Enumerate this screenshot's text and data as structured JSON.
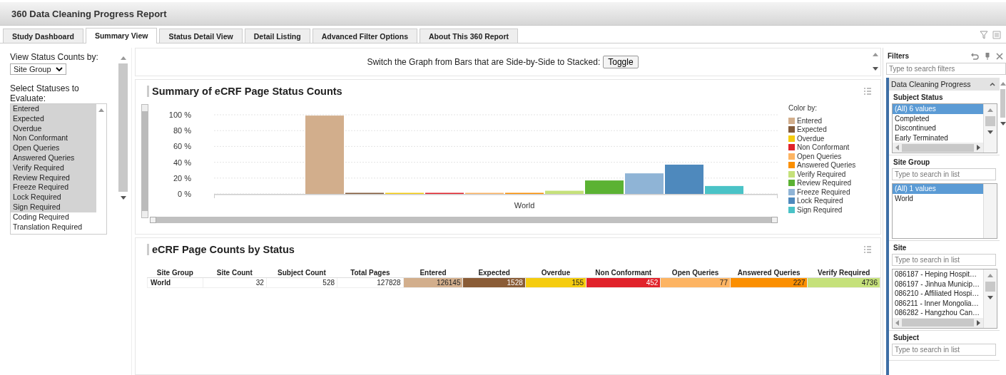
{
  "window": {
    "title": "360 Data Cleaning Progress Report"
  },
  "tabs": [
    {
      "label": "Study Dashboard",
      "selected": false
    },
    {
      "label": "Summary View",
      "selected": true
    },
    {
      "label": "Status Detail View",
      "selected": false
    },
    {
      "label": "Detail Listing",
      "selected": false
    },
    {
      "label": "Advanced Filter Options",
      "selected": false
    },
    {
      "label": "About This 360 Report",
      "selected": false
    }
  ],
  "left_panel": {
    "view_by_label": "View Status Counts by:",
    "view_by_value": "Site Group",
    "statuses_label": "Select Statuses to Evaluate:",
    "statuses": [
      {
        "label": "Entered",
        "selected": true
      },
      {
        "label": "Expected",
        "selected": true
      },
      {
        "label": "Overdue",
        "selected": true
      },
      {
        "label": "Non Conformant",
        "selected": true
      },
      {
        "label": "Open Queries",
        "selected": true
      },
      {
        "label": "Answered Queries",
        "selected": true
      },
      {
        "label": "Verify Required",
        "selected": true
      },
      {
        "label": "Review Required",
        "selected": true
      },
      {
        "label": "Freeze Required",
        "selected": true
      },
      {
        "label": "Lock Required",
        "selected": true
      },
      {
        "label": "Sign Required",
        "selected": true
      },
      {
        "label": "Coding Required",
        "selected": false
      },
      {
        "label": "Translation Required",
        "selected": false
      }
    ]
  },
  "toggle_bar": {
    "text": "Switch the Graph from Bars that are Side-by-Side to Stacked:",
    "button": "Toggle"
  },
  "chart_panel": {
    "title": "Summary of eCRF Page Status Counts",
    "legend_title": "Color by:",
    "chart_data": {
      "type": "bar",
      "grid": true,
      "categories": [
        "World"
      ],
      "ylim": [
        0,
        100
      ],
      "yticks": [
        {
          "value": 0,
          "label": "0 %"
        },
        {
          "value": 20,
          "label": "20 %"
        },
        {
          "value": 40,
          "label": "40 %"
        },
        {
          "value": 60,
          "label": "60 %"
        },
        {
          "value": 80,
          "label": "80 %"
        },
        {
          "value": 100,
          "label": "100 %"
        }
      ],
      "series": [
        {
          "name": "Entered",
          "color": "#d2ae8c",
          "values": [
            99
          ]
        },
        {
          "name": "Expected",
          "color": "#825a3a",
          "values": [
            1
          ]
        },
        {
          "name": "Overdue",
          "color": "#f5cc0e",
          "values": [
            0
          ]
        },
        {
          "name": "Non Conformant",
          "color": "#e1222a",
          "values": [
            0
          ]
        },
        {
          "name": "Open Queries",
          "color": "#fdb462",
          "values": [
            0
          ]
        },
        {
          "name": "Answered Queries",
          "color": "#fb8f00",
          "values": [
            0
          ]
        },
        {
          "name": "Verify Required",
          "color": "#c5e17a",
          "values": [
            4
          ]
        },
        {
          "name": "Review Required",
          "color": "#5bb233",
          "values": [
            17
          ]
        },
        {
          "name": "Freeze Required",
          "color": "#8fb4d6",
          "values": [
            26
          ]
        },
        {
          "name": "Lock Required",
          "color": "#4e89bd",
          "values": [
            37
          ]
        },
        {
          "name": "Sign Required",
          "color": "#4ac3c7",
          "values": [
            10
          ]
        }
      ]
    }
  },
  "table_panel": {
    "title": "eCRF Page Counts by Status",
    "columns": [
      {
        "label": "Site Group"
      },
      {
        "label": "Site Count"
      },
      {
        "label": "Subject Count"
      },
      {
        "label": "Total Pages"
      },
      {
        "label": "Entered",
        "color": "#d2ae8c"
      },
      {
        "label": "Expected",
        "color": "#8a5c36"
      },
      {
        "label": "Overdue",
        "color": "#f5cc0e"
      },
      {
        "label": "Non Conformant",
        "color": "#e1222a"
      },
      {
        "label": "Open Queries",
        "color": "#fdb462"
      },
      {
        "label": "Answered Queries",
        "color": "#fb8f00"
      },
      {
        "label": "Verify Required",
        "color": "#c5e17a"
      }
    ],
    "rows": [
      [
        "World",
        "32",
        "528",
        "127828",
        "126145",
        "1528",
        "155",
        "452",
        "77",
        "227",
        "4736"
      ]
    ]
  },
  "filters": {
    "title": "Filters",
    "search_placeholder": "Type to search filters",
    "group": "Data Cleaning Progress",
    "sections": [
      {
        "title": "Subject Status",
        "items": [
          {
            "label": "(All) 6 values",
            "selected": true
          },
          {
            "label": "Completed",
            "selected": false
          },
          {
            "label": "Discontinued",
            "selected": false
          },
          {
            "label": "Early Terminated",
            "selected": false
          }
        ]
      },
      {
        "title": "Site Group",
        "placeholder": "Type to search in list",
        "items": [
          {
            "label": "(All) 1 values",
            "selected": true
          },
          {
            "label": "World",
            "selected": false
          }
        ]
      },
      {
        "title": "Site",
        "placeholder": "Type to search in list",
        "items": [
          {
            "label": "086187 - Heping Hospit…",
            "selected": false
          },
          {
            "label": "086197 - Jinhua Municip…",
            "selected": false
          },
          {
            "label": "086210 - Affiliated Hospi…",
            "selected": false
          },
          {
            "label": "086211 - Inner Mongolia…",
            "selected": false
          },
          {
            "label": "086282 - Hangzhou Can…",
            "selected": false
          }
        ]
      },
      {
        "title": "Subject",
        "placeholder": "Type to search in list"
      }
    ]
  }
}
